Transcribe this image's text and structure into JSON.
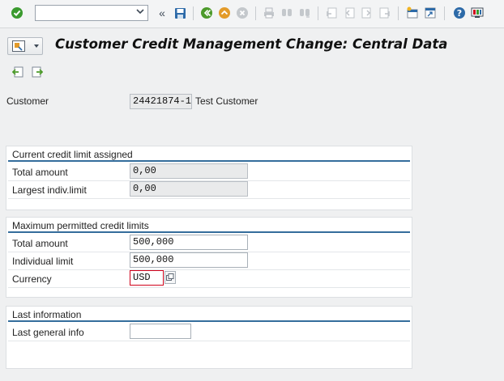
{
  "toolbar": {
    "command_field_value": "",
    "icons": [
      "enter-icon",
      "back-double-icon",
      "save-icon",
      "back-icon",
      "exit-icon",
      "cancel-icon",
      "print-icon",
      "find-icon",
      "find-next-icon",
      "first-page-icon",
      "previous-page-icon",
      "next-page-icon",
      "last-page-icon",
      "new-session-icon",
      "shortcut-icon",
      "help-icon",
      "customize-layout-icon"
    ]
  },
  "title": "Customer Credit Management Change: Central Data",
  "customer": {
    "label": "Customer",
    "number": "24421874-1",
    "name": "Test Customer"
  },
  "current_limit": {
    "title": "Current credit limit assigned",
    "total_amount_label": "Total amount",
    "total_amount_value": "0,00",
    "largest_limit_label": "Largest indiv.limit",
    "largest_limit_value": "0,00"
  },
  "maximum_limits": {
    "title": "Maximum permitted credit limits",
    "total_amount_label": "Total amount",
    "total_amount_value": "500,000",
    "individual_limit_label": "Individual limit",
    "individual_limit_value": "500,000",
    "currency_label": "Currency",
    "currency_value": "USD"
  },
  "last_info": {
    "title": "Last information",
    "last_general_label": "Last general info",
    "last_general_value": ""
  },
  "colors": {
    "accent": "#346d9c",
    "enter_green": "#3a9a2e",
    "nav_green": "#4c9a2a",
    "nav_orange": "#e39b2a",
    "save_blue": "#2d6aa8",
    "help_blue": "#2d6aa8",
    "required_red": "#d0021b"
  }
}
